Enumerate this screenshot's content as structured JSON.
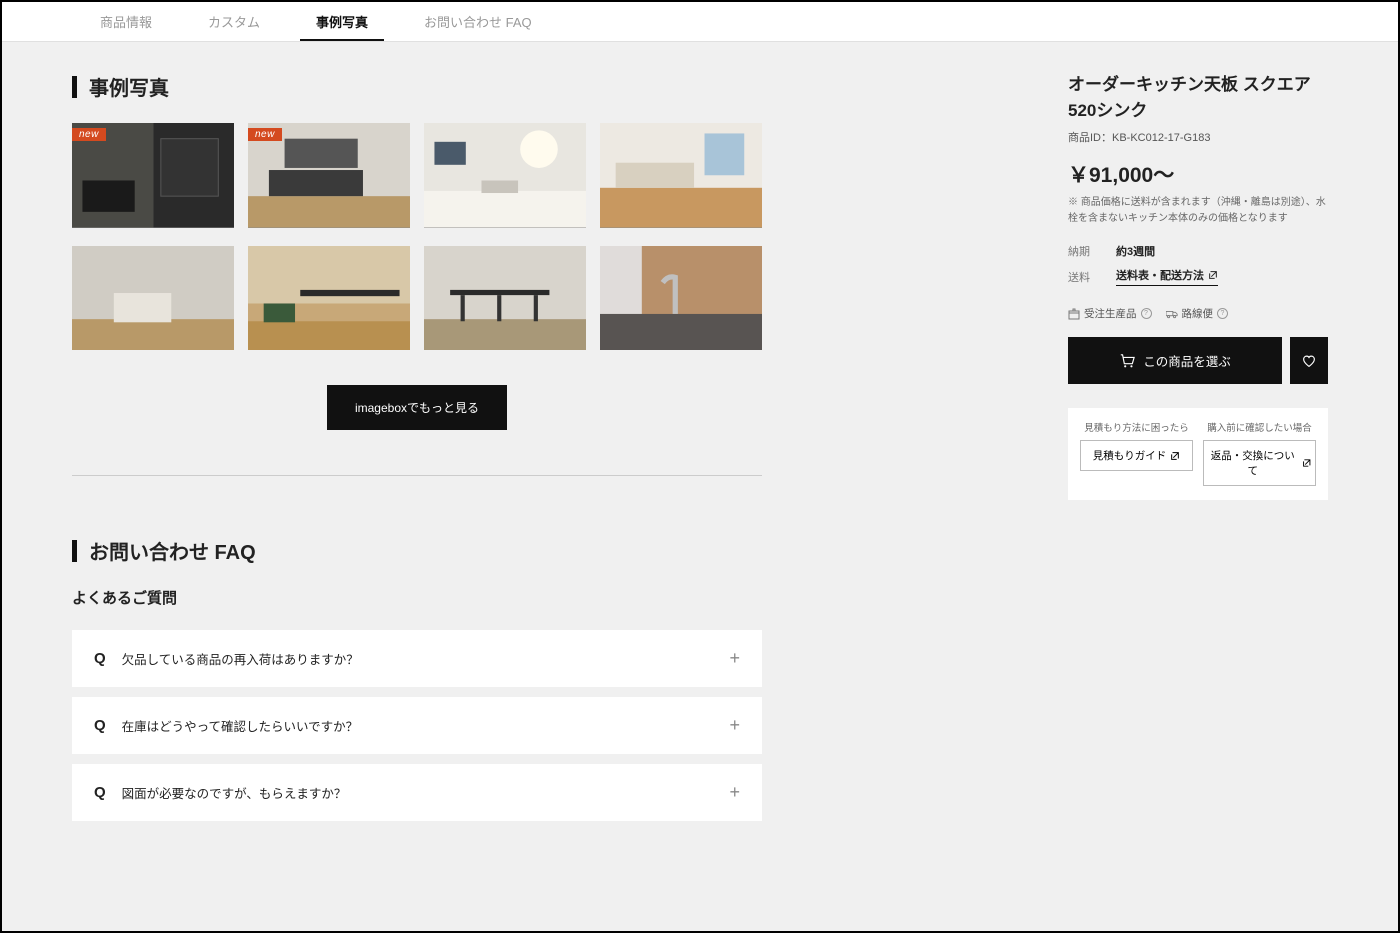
{
  "tabs": [
    "商品情報",
    "カスタム",
    "事例写真",
    "お問い合わせ FAQ"
  ],
  "activeTab": 2,
  "section_cases": "事例写真",
  "thumbs": [
    {
      "new": true
    },
    {
      "new": true
    },
    {
      "new": false
    },
    {
      "new": false
    },
    {
      "new": false
    },
    {
      "new": false
    },
    {
      "new": false
    },
    {
      "new": false
    }
  ],
  "new_label": "new",
  "more_btn": "imageboxでもっと見る",
  "section_faq": "お問い合わせ FAQ",
  "faq_sub": "よくあるご質問",
  "faq_q_mark": "Q",
  "faqs": [
    "欠品している商品の再入荷はありますか？",
    "在庫はどうやって確認したらいいですか？",
    "図面が必要なのですが、もらえますか？"
  ],
  "product": {
    "title": "オーダーキッチン天板 スクエア520シンク",
    "id_label": "商品ID：KB-KC012-17-G183",
    "price": "￥91,000〜",
    "price_note": "※ 商品価格に送料が含まれます（沖縄・離島は別途）、水栓を含まないキッチン本体のみの価格となります",
    "lead_label": "納期",
    "lead_value": "約3週間",
    "ship_label": "送料",
    "ship_link": "送料表・配送方法",
    "tag1": "受注生産品",
    "tag2": "路線便",
    "cart_btn": "この商品を選ぶ",
    "help1_cap": "見積もり方法に困ったら",
    "help1_btn": "見積もりガイド",
    "help2_cap": "購入前に確認したい場合",
    "help2_btn": "返品・交換について"
  }
}
